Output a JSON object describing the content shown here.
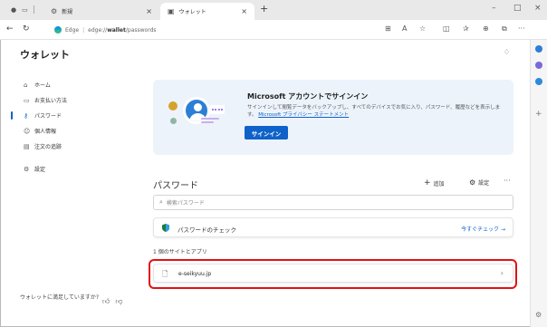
{
  "browser": {
    "tabs": [
      {
        "label": "新規",
        "icon": "gear-icon",
        "active": false
      },
      {
        "label": "ウォレット",
        "icon": "wallet-icon",
        "active": true
      }
    ],
    "address": {
      "edge_label": "Edge",
      "url_host": "edge://",
      "url_bold": "wallet",
      "url_path": "/passwords"
    }
  },
  "wallet": {
    "title": "ウォレット",
    "nav": [
      {
        "label": "ホーム",
        "icon": "home-icon"
      },
      {
        "label": "お支払い方法",
        "icon": "credit-card-icon"
      },
      {
        "label": "パスワード",
        "icon": "key-icon",
        "active": true
      },
      {
        "label": "個人情報",
        "icon": "person-icon"
      },
      {
        "label": "注文の追跡",
        "icon": "receipt-icon"
      }
    ],
    "settings_label": "設定",
    "feedback_text": "ウォレットに満足していますか?"
  },
  "banner": {
    "title": "Microsoft アカウントでサインイン",
    "desc": "サインインして閲覧データをバックアップし、すべてのデバイスでお気に入り、パスワード、履歴などを表示します。",
    "link": "Microsoft プライバシー ステートメント",
    "button": "サインイン"
  },
  "passwords": {
    "title": "パスワード",
    "add_label": "追加",
    "settings_label": "設定",
    "search_placeholder": "検索パスワード",
    "check_label": "パスワードのチェック",
    "check_link": "今すぐチェック →",
    "count_label": "1 個のサイトとアプリ",
    "sites": [
      {
        "name": "e-seikyuu.jp"
      }
    ]
  },
  "colors": {
    "accent": "#0f62c9",
    "highlight": "#e01212",
    "banner_bg": "#edf3fb"
  }
}
